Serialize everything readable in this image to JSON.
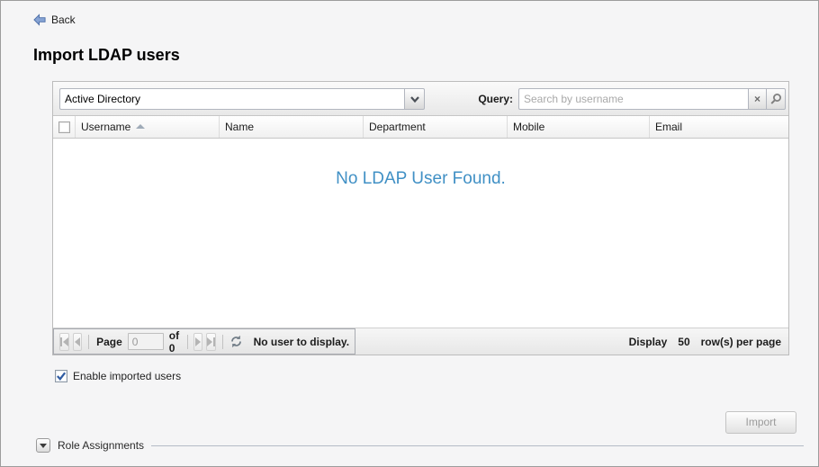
{
  "back": {
    "label": "Back"
  },
  "page_title": "Import LDAP users",
  "toolbar": {
    "directory_select": {
      "value": "Active Directory"
    },
    "query_label": "Query:",
    "search_placeholder": "Search by username"
  },
  "table": {
    "columns": [
      "Username",
      "Name",
      "Department",
      "Mobile",
      "Email"
    ],
    "sort_column": "Username",
    "sort_direction": "asc",
    "empty_text": "No LDAP User Found.",
    "rows": []
  },
  "pager": {
    "page_label": "Page",
    "page_value": "0",
    "of_label": "of 0",
    "status_text": "No user to display.",
    "display_label": "Display",
    "display_value": "50",
    "display_suffix": "row(s) per page"
  },
  "options": {
    "enable_imported_label": "Enable imported users",
    "enable_imported_checked": true
  },
  "actions": {
    "import_label": "Import"
  },
  "role_assignments": {
    "label": "Role Assignments",
    "collapsed": false
  },
  "icons": {
    "clear": "×"
  },
  "colors": {
    "empty_text_blue": "#4090c5",
    "back_arrow_blue": "#86a3d4",
    "checkmark_blue": "#2f5ca3",
    "page_background": "#f5f5f6"
  }
}
